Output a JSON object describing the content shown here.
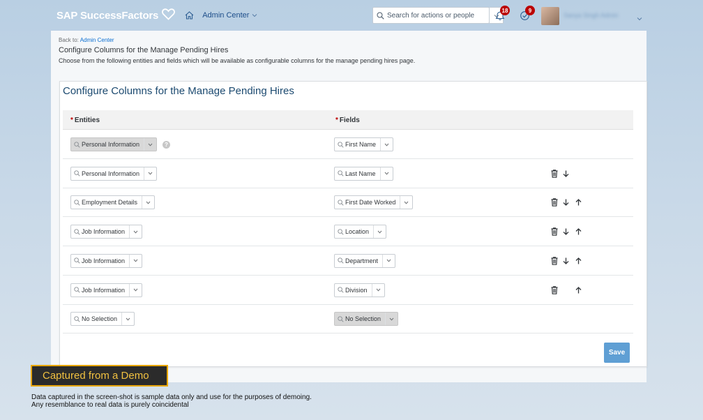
{
  "shell": {
    "brand": "SAP SuccessFactors",
    "menu_label": "Admin Center",
    "search_placeholder": "Search for actions or people",
    "notification_count": "18",
    "todo_count": "9",
    "user_name": "Sanya Singh Admin"
  },
  "page": {
    "back_prefix": "Back to:",
    "back_link": "Admin Center",
    "title": "Configure Columns for the Manage Pending Hires",
    "description": "Choose from the following entities and fields which will be available as configurable columns for the manage pending hires page."
  },
  "panel": {
    "title": "Configure Columns for the Manage Pending Hires",
    "col_entities": "Entities",
    "col_fields": "Fields",
    "required_mark": "*",
    "help_mark": "?",
    "save_label": "Save"
  },
  "rows": [
    {
      "entity": "Personal Information",
      "field": "First Name",
      "entity_disabled": true,
      "help": true,
      "delete": false,
      "down": false,
      "up": false
    },
    {
      "entity": "Personal Information",
      "field": "Last Name",
      "delete": true,
      "down": true,
      "up": false
    },
    {
      "entity": "Employment Details",
      "field": "First Date Worked",
      "delete": true,
      "down": true,
      "up": true
    },
    {
      "entity": "Job Information",
      "field": "Location",
      "delete": true,
      "down": true,
      "up": true
    },
    {
      "entity": "Job Information",
      "field": "Department",
      "delete": true,
      "down": true,
      "up": true
    },
    {
      "entity": "Job Information",
      "field": "Division",
      "delete": true,
      "down": false,
      "up": true
    },
    {
      "entity": "No Selection",
      "field": "No Selection",
      "field_disabled": true,
      "delete": false,
      "down": false,
      "up": false
    }
  ],
  "demo": {
    "banner": "Captured from a Demo",
    "line1": "Data captured in the screen-shot is sample data only and use for the purposes of demoing.",
    "line2": "Any resemblance to real data is purely coincidental"
  },
  "colors": {
    "brand_accent": "#1c4a70",
    "link": "#0a6ed1",
    "save_button": "#5f9fd4",
    "badge": "#bb0000",
    "demo_border": "#e8a600"
  }
}
